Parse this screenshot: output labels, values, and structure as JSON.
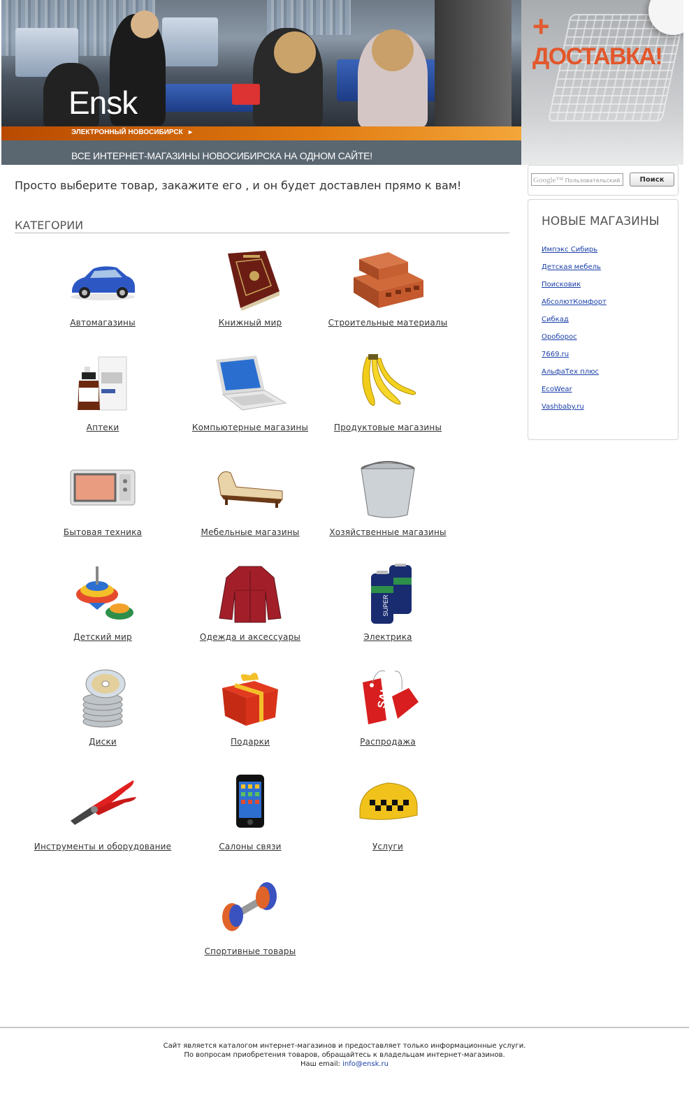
{
  "header": {
    "logo_text": "Ensk",
    "tagline": "ЭЛЕКТРОННЫЙ НОВОСИБИРСК",
    "slogan": "ВСЕ ИНТЕРНЕТ-МАГАЗИНЫ НОВОСИБИРСКА  НА ОДНОМ САЙТЕ!"
  },
  "promo": {
    "plus": "+",
    "text": "ДОСТАВКА!"
  },
  "intro": "Просто выберите товар, закажите его , и он будет доставлен прямо к вам!",
  "categories_heading": "КАТЕГОРИИ",
  "categories": [
    {
      "label": "Автомагазины",
      "icon": "car-icon"
    },
    {
      "label": "Книжный мир",
      "icon": "book-icon"
    },
    {
      "label": "Строительные материалы",
      "icon": "brick-icon"
    },
    {
      "label": "Аптеки",
      "icon": "medicine-icon"
    },
    {
      "label": "Компьютерные магазины",
      "icon": "laptop-icon"
    },
    {
      "label": "Продуктовые магазины",
      "icon": "bananas-icon"
    },
    {
      "label": "Бытовая техника",
      "icon": "microwave-icon"
    },
    {
      "label": "Мебельные магазины",
      "icon": "sofa-icon"
    },
    {
      "label": "Хозяйственные магазины",
      "icon": "bucket-icon"
    },
    {
      "label": "Детский мир",
      "icon": "spinning-top-icon"
    },
    {
      "label": "Одежда и аксессуары",
      "icon": "jacket-icon"
    },
    {
      "label": "Электрика",
      "icon": "batteries-icon"
    },
    {
      "label": "Диски",
      "icon": "discs-icon"
    },
    {
      "label": "Подарки",
      "icon": "gift-icon"
    },
    {
      "label": "Распродажа",
      "icon": "sale-tag-icon"
    },
    {
      "label": "Инструменты и оборудование",
      "icon": "pliers-icon"
    },
    {
      "label": "Салоны связи",
      "icon": "phone-icon"
    },
    {
      "label": "Услуги",
      "icon": "taxi-sign-icon"
    },
    {
      "label": "Спортивные товары",
      "icon": "dumbbell-icon"
    }
  ],
  "search": {
    "brand": "Google™",
    "placeholder": "Пользовательский",
    "button_label": "Поиск"
  },
  "new_shops": {
    "title": "НОВЫЕ МАГАЗИНЫ",
    "items": [
      "Импэкс Сибирь",
      "Детская мебель",
      "Поисковик",
      "АбсолютКомфорт",
      "Сибкад",
      "Ороборос",
      "7669.ru",
      "АльфаТех плюс",
      "EcoWear",
      "Vashbaby.ru"
    ]
  },
  "footer": {
    "line1": "Сайт является каталогом интернет-магазинов и предоставляет только информационные услуги.",
    "line2": "По вопросам приобретения товаров, обращайтесь к владельцам интернет-магазинов.",
    "email_label": "Наш email:",
    "email": "info@ensk.ru"
  },
  "colors": {
    "accent_orange": "#e07a10",
    "slogan_bar": "#5a6670",
    "link": "#1a3fa8"
  }
}
